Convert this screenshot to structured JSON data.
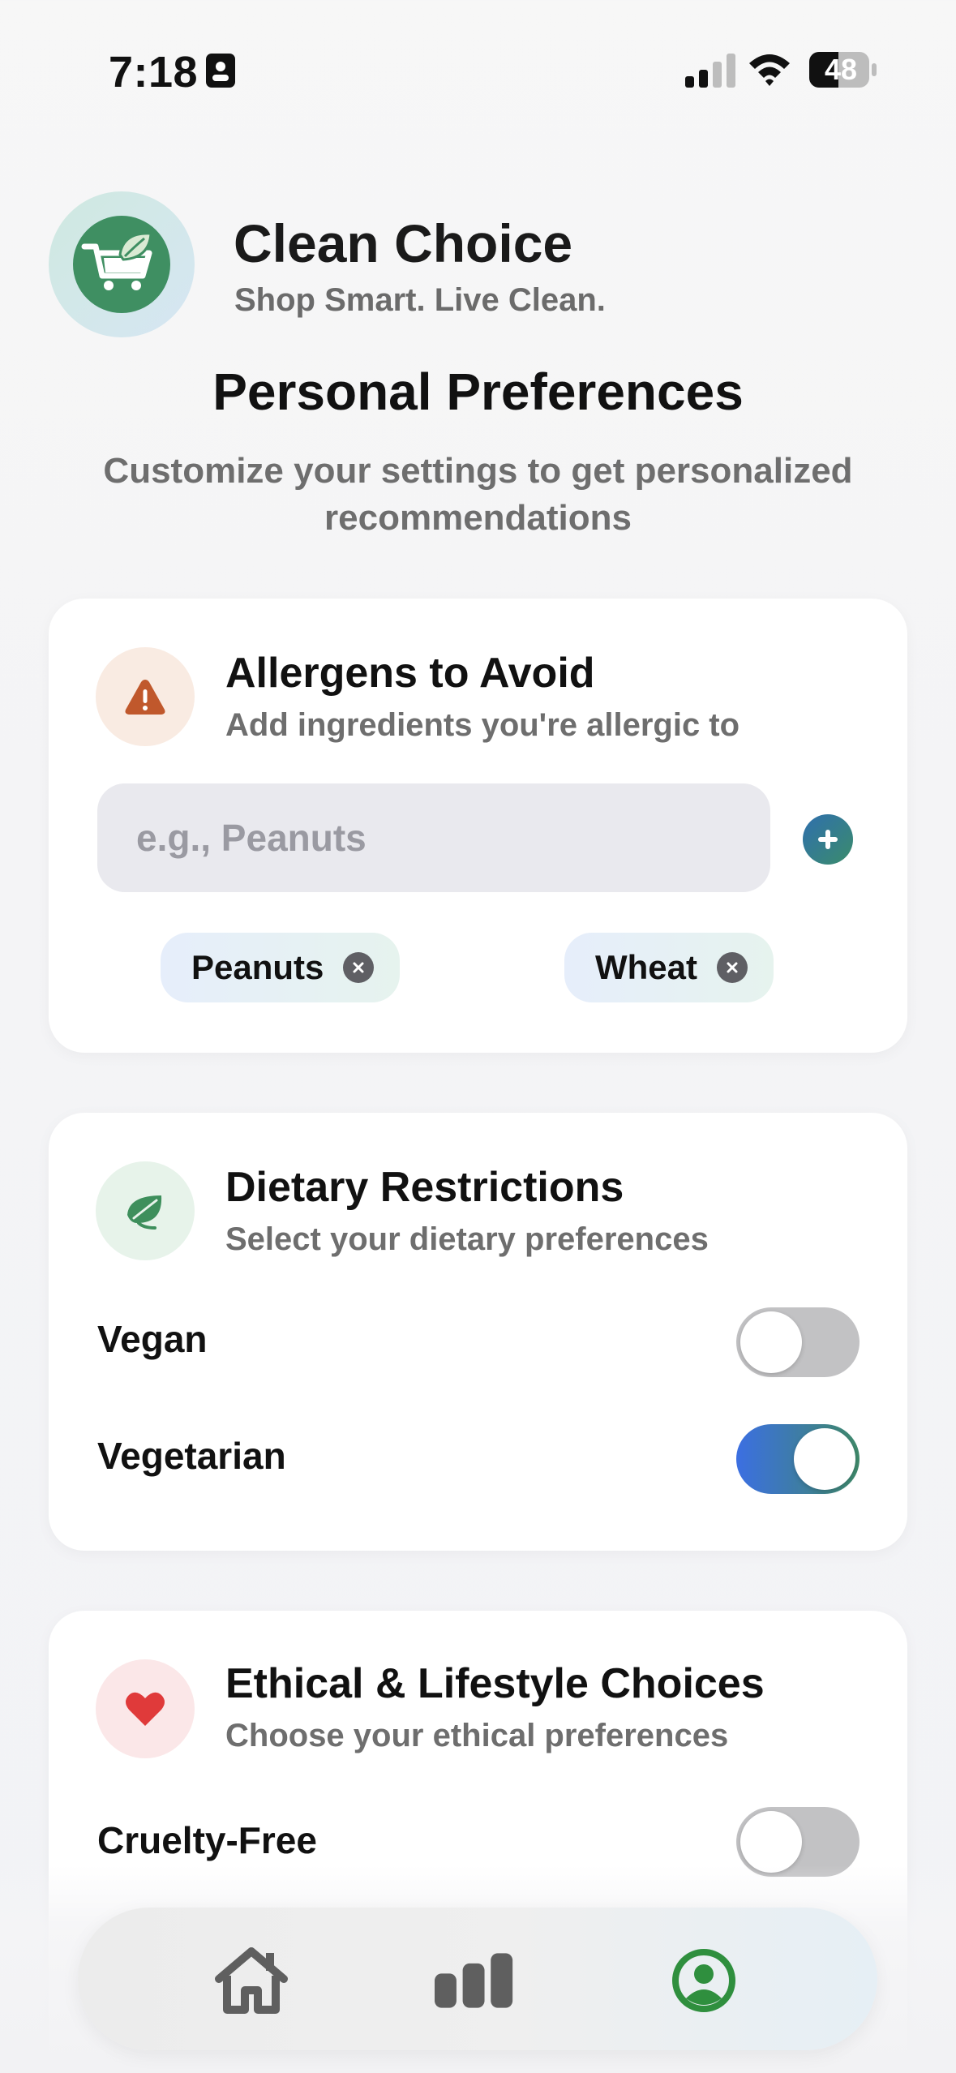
{
  "status_bar": {
    "time": "7:18",
    "battery": "48"
  },
  "app": {
    "title": "Clean Choice",
    "tagline": "Shop Smart. Live Clean.",
    "logo_icon": "cart-leaf-icon"
  },
  "page": {
    "title": "Personal Preferences",
    "subtitle": "Customize your settings to get personalized recommendations"
  },
  "allergens": {
    "title": "Allergens to Avoid",
    "subtitle": "Add ingredients you're allergic to",
    "icon": "warning-icon",
    "input": {
      "placeholder": "e.g., Peanuts",
      "value": ""
    },
    "chips": [
      {
        "label": "Peanuts"
      },
      {
        "label": "Wheat"
      }
    ]
  },
  "dietary": {
    "title": "Dietary Restrictions",
    "subtitle": "Select your dietary preferences",
    "icon": "leaf-icon",
    "options": [
      {
        "label": "Vegan",
        "enabled": false
      },
      {
        "label": "Vegetarian",
        "enabled": true
      }
    ]
  },
  "ethical": {
    "title": "Ethical & Lifestyle Choices",
    "subtitle": "Choose your ethical preferences",
    "icon": "heart-icon",
    "options": [
      {
        "label": "Cruelty-Free",
        "enabled": false
      }
    ]
  },
  "tab_bar": {
    "tabs": [
      {
        "icon": "home-icon",
        "active": false
      },
      {
        "icon": "bar-chart-icon",
        "active": false
      },
      {
        "icon": "profile-icon",
        "active": true
      }
    ]
  },
  "colors": {
    "accent_green": "#3f8f62",
    "toggle_on_start": "#3c6fe2",
    "toggle_on_end": "#3f8a6a",
    "warning": "#c0582c",
    "heart": "#e03a3a"
  }
}
